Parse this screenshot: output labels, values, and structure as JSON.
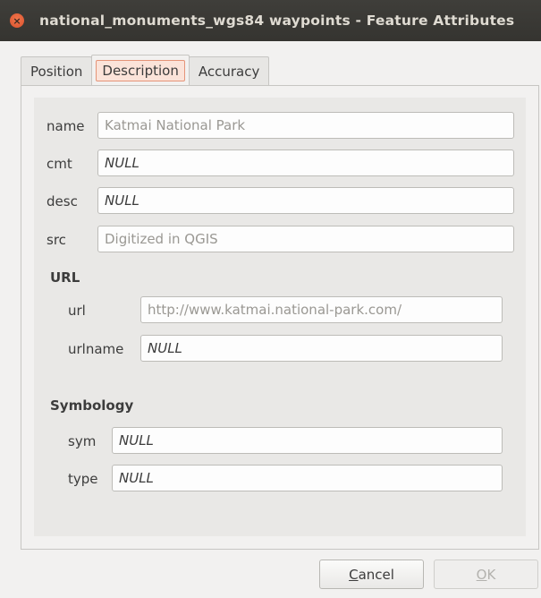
{
  "window": {
    "title": "national_monuments_wgs84 waypoints - Feature Attributes",
    "close_glyph": "×"
  },
  "tabs": [
    {
      "label": "Position",
      "active": false
    },
    {
      "label": "Description",
      "active": true
    },
    {
      "label": "Accuracy",
      "active": false
    }
  ],
  "fields": {
    "name": {
      "label": "name",
      "value": "Katmai National Park"
    },
    "cmt": {
      "label": "cmt",
      "value": "NULL"
    },
    "desc": {
      "label": "desc",
      "value": "NULL"
    },
    "src": {
      "label": "src",
      "value": "Digitized in QGIS"
    }
  },
  "url_section": {
    "title": "URL",
    "url": {
      "label": "url",
      "value": "http://www.katmai.national-park.com/"
    },
    "urlname": {
      "label": "urlname",
      "value": "NULL"
    }
  },
  "symbology_section": {
    "title": "Symbology",
    "sym": {
      "label": "sym",
      "value": "NULL"
    },
    "type": {
      "label": "type",
      "value": "NULL"
    }
  },
  "buttons": {
    "cancel": {
      "mnemonic": "C",
      "rest": "ancel"
    },
    "ok": {
      "mnemonic": "O",
      "rest": "K",
      "enabled": false
    }
  },
  "colors": {
    "titlebar": "#3c3b37",
    "close": "#e0603a",
    "active_tab_highlight": "#fbe3d9"
  }
}
